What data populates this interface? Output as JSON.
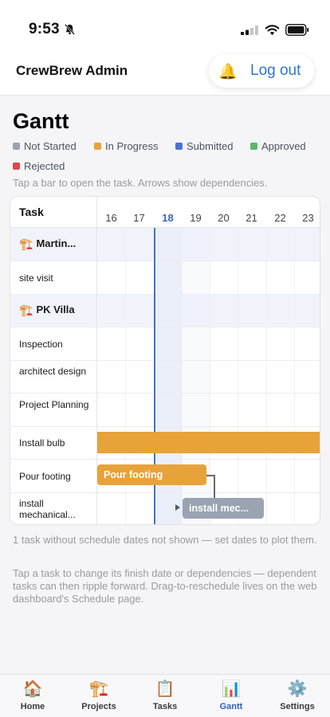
{
  "status_bar": {
    "time": "9:53"
  },
  "header": {
    "app_title": "CrewBrew Admin",
    "logout_label": "Log out"
  },
  "page": {
    "title": "Gantt",
    "hint": "Tap a bar to open the task. Arrows show dependencies."
  },
  "legend": [
    {
      "label": "Not Started",
      "color": "#9aa3b2"
    },
    {
      "label": "In Progress",
      "color": "#e8a23a"
    },
    {
      "label": "Submitted",
      "color": "#4a72d6"
    },
    {
      "label": "Approved",
      "color": "#58b96b"
    },
    {
      "label": "Rejected",
      "color": "#d9484c"
    }
  ],
  "gantt": {
    "task_column_label": "Task",
    "days": [
      "16",
      "17",
      "18",
      "19",
      "20",
      "21",
      "22",
      "23"
    ],
    "today": "18",
    "rows": [
      {
        "label": "Martin...",
        "type": "project"
      },
      {
        "label": "site visit",
        "type": "task"
      },
      {
        "label": "PK Villa",
        "type": "project"
      },
      {
        "label": "Inspection",
        "type": "task"
      },
      {
        "label": "architect design",
        "type": "task"
      },
      {
        "label": "Project Planning",
        "type": "task"
      },
      {
        "label": "Install bulb",
        "type": "task"
      },
      {
        "label": "Pour footing",
        "type": "task"
      },
      {
        "label": "install mechanical...",
        "type": "task"
      }
    ],
    "bars": [
      {
        "task": "Install bulb",
        "label": "",
        "status": "In Progress"
      },
      {
        "task": "Pour footing",
        "label": "Pour footing",
        "status": "In Progress"
      },
      {
        "task": "install mechanical...",
        "label": "install mec...",
        "status": "Not Started"
      }
    ]
  },
  "notes": {
    "unscheduled": "1 task without schedule dates not shown — set dates to plot them.",
    "help": "Tap a task to change its finish date or dependencies — dependent tasks can then ripple forward. Drag-to-reschedule lives on the web dashboard's Schedule page."
  },
  "tabbar": [
    {
      "label": "Home",
      "icon": "home-icon",
      "active": false
    },
    {
      "label": "Projects",
      "icon": "crane-icon",
      "active": false
    },
    {
      "label": "Tasks",
      "icon": "clipboard-icon",
      "active": false
    },
    {
      "label": "Gantt",
      "icon": "bar-chart-icon",
      "active": true
    },
    {
      "label": "Settings",
      "icon": "gear-icon",
      "active": false
    }
  ]
}
